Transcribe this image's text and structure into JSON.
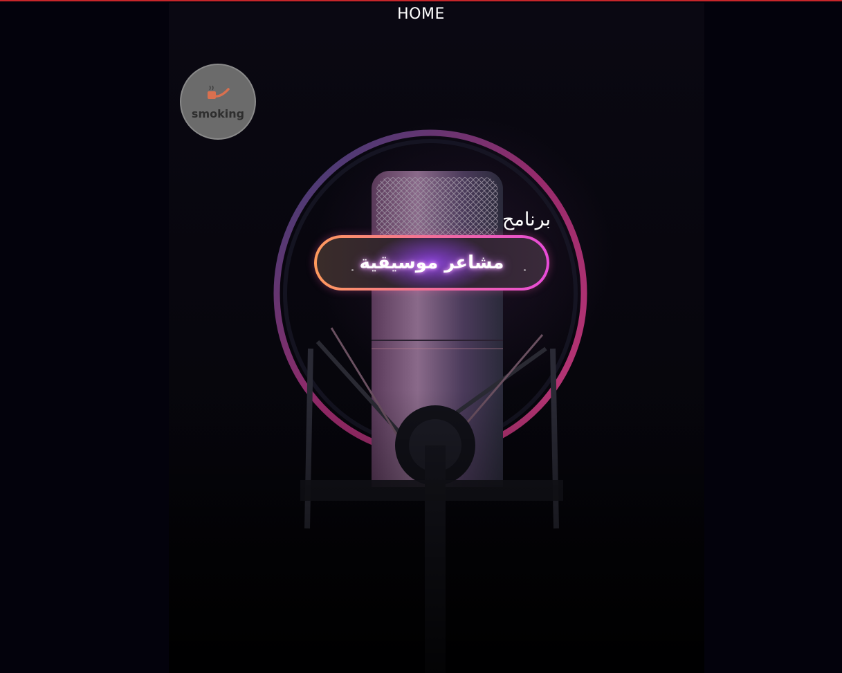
{
  "nav": {
    "home_label": "HOME"
  },
  "smoking_button": {
    "label": "smoking",
    "icon": "pipe-icon"
  },
  "program": {
    "label": "برنامح",
    "button_text": "مشاعر موسيقية"
  },
  "colors": {
    "background": "#03020c",
    "top_border": "#c6262a",
    "button_gradient_start": "#ff9a5c",
    "button_gradient_end": "#e84bd8",
    "button_glow": "#9646f0",
    "smoking_button_bg": "#6b6b6b"
  },
  "hero_image": {
    "subject": "studio-microphone-with-pop-filter"
  }
}
